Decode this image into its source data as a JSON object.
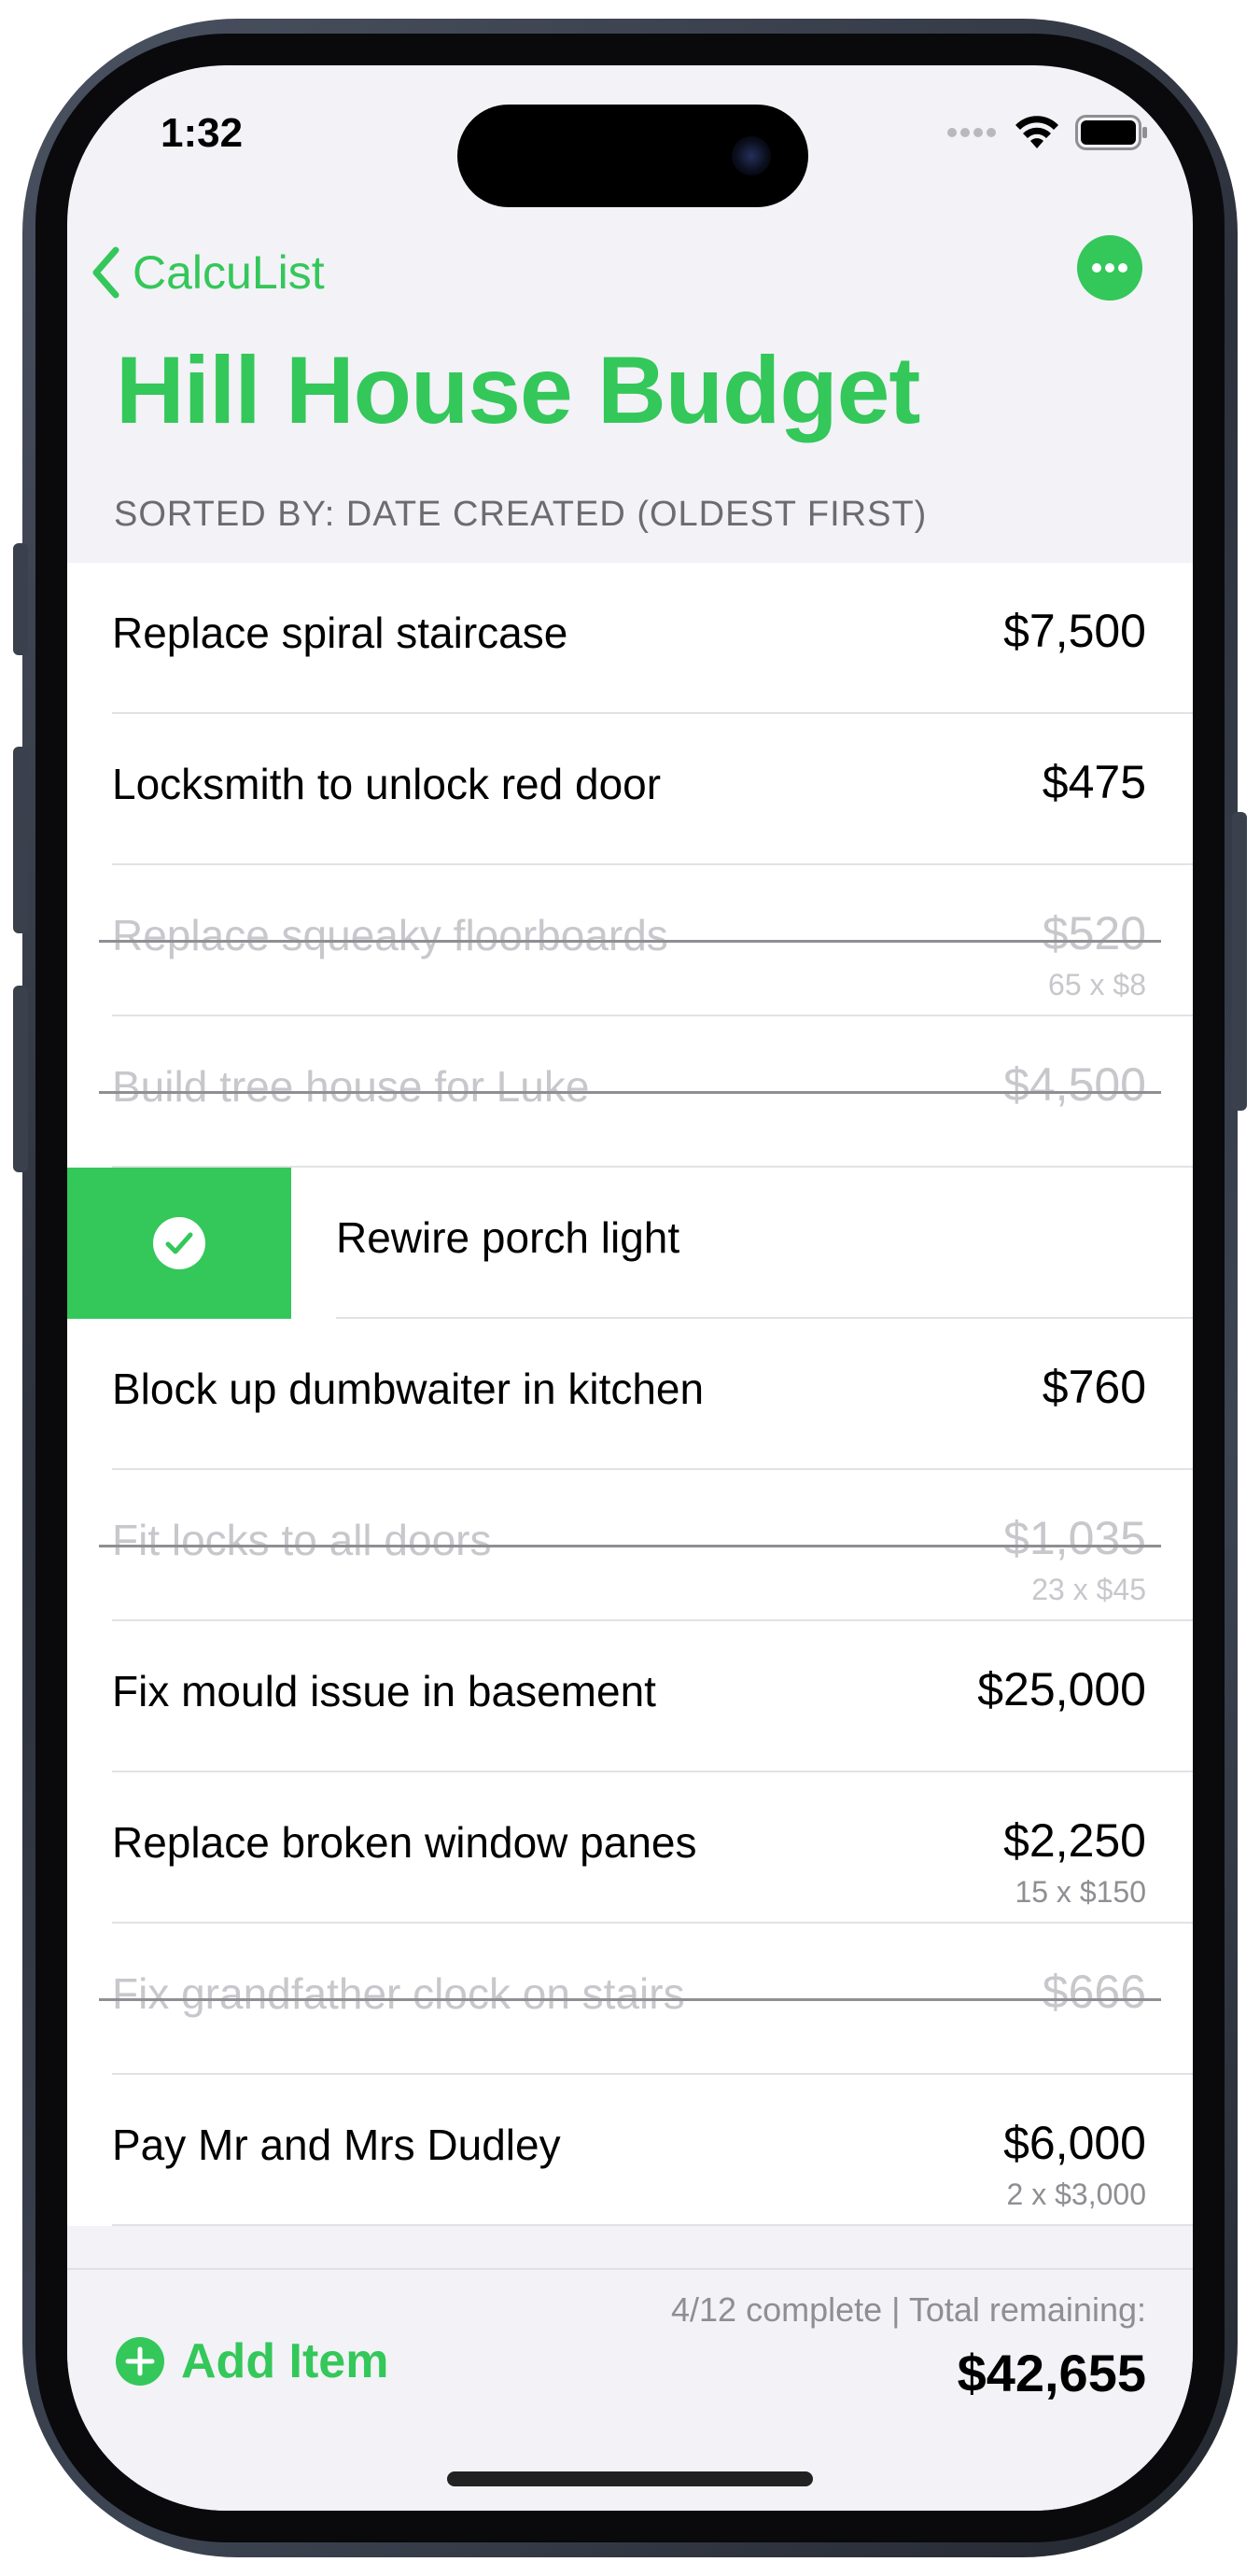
{
  "status": {
    "time": "1:32"
  },
  "nav": {
    "back_label": "CalcuList"
  },
  "header": {
    "title": "Hill House Budget",
    "sort": "SORTED BY: DATE CREATED (OLDEST FIRST)"
  },
  "items": [
    {
      "name": "Replace spiral staircase",
      "amount": "$7,500",
      "calc": "",
      "done": false
    },
    {
      "name": "Locksmith to unlock red door",
      "amount": "$475",
      "calc": "",
      "done": false
    },
    {
      "name": "Replace squeaky floorboards",
      "amount": "$520",
      "calc": "65 x $8",
      "done": true
    },
    {
      "name": "Build tree house for Luke",
      "amount": "$4,500",
      "calc": "",
      "done": true
    },
    {
      "name": "Rewire porch light",
      "amount": "",
      "calc": "",
      "done": false,
      "swiped": true
    },
    {
      "name": "Block up dumbwaiter in kitchen",
      "amount": "$760",
      "calc": "",
      "done": false
    },
    {
      "name": "Fit locks to all doors",
      "amount": "$1,035",
      "calc": "23 x $45",
      "done": true
    },
    {
      "name": "Fix mould issue in basement",
      "amount": "$25,000",
      "calc": "",
      "done": false
    },
    {
      "name": "Replace broken window panes",
      "amount": "$2,250",
      "calc": "15 x $150",
      "done": false
    },
    {
      "name": "Fix grandfather clock on stairs",
      "amount": "$666",
      "calc": "",
      "done": true
    },
    {
      "name": "Pay Mr and Mrs Dudley",
      "amount": "$6,000",
      "calc": "2 x $3,000",
      "done": false
    }
  ],
  "footer": {
    "add_label": "Add Item",
    "summary": "4/12 complete | Total remaining:",
    "total": "$42,655"
  },
  "colors": {
    "accent": "#34c759",
    "done_text": "#c7c7cc",
    "secondary_text": "#8e8e93"
  }
}
